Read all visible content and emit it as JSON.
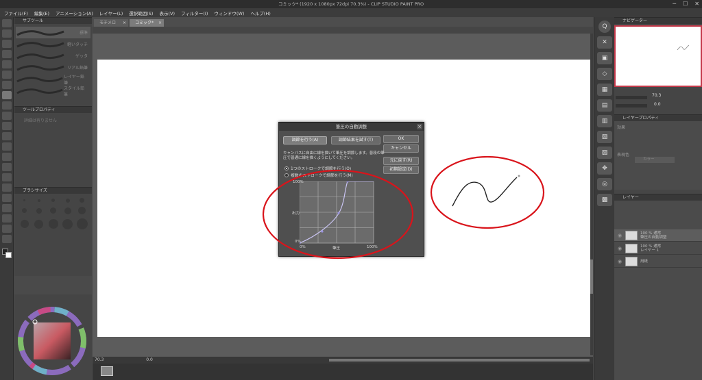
{
  "app": {
    "title": "コミック* (1920 x 1080px 72dpi 70.3%) - CLIP STUDIO PAINT PRO"
  },
  "menu": [
    "ファイル(F)",
    "編集(E)",
    "アニメーション(A)",
    "レイヤー(L)",
    "選択範囲(S)",
    "表示(V)",
    "フィルター(I)",
    "ウィンドウ(W)",
    "ヘルプ(H)"
  ],
  "tabs": [
    {
      "label": "モチメロ"
    },
    {
      "label": "コミック*"
    }
  ],
  "subtool": {
    "panel_title": "サブツール",
    "brushes": [
      {
        "name": "標準"
      },
      {
        "name": "軽いタッチ"
      },
      {
        "name": "ゲッタ"
      },
      {
        "name": "リアル鉛筆"
      },
      {
        "name": "レイヤー鉛筆"
      },
      {
        "name": "スタイル鉛筆"
      }
    ]
  },
  "toolprop": {
    "panel_title": "ツールプロパティ",
    "empty": "詳細は有りません"
  },
  "brushsize": {
    "panel_title": "ブラシサイズ"
  },
  "dialog": {
    "title": "筆圧の自動調整",
    "btn_adjust": "調節を行う(A)",
    "btn_try": "調節結果を試す(T)",
    "btn_ok": "OK",
    "btn_cancel": "キャンセル",
    "btn_undo": "元に戻す(R)",
    "btn_reset": "初期設定(D)",
    "instruction": "キャンバスに自由に線を描いて筆圧を調節します。普段の筆圧で普通に線を描くようにしてください。",
    "radio_single": "1つのストロークで調節を行う(O)",
    "radio_multi": "複数のストロークで調節を行う(M)",
    "graph": {
      "y_top": "100%",
      "y_label": "出力",
      "y_bottom": "0%",
      "x_left": "0%",
      "x_label": "筆圧",
      "x_right": "100%"
    }
  },
  "status": {
    "zoom": "70.3",
    "angle": "0.0"
  },
  "right": {
    "nav_title": "ナビゲーター",
    "nav_zoom": "70.3",
    "nav_angle": "0.0",
    "layerprop_title": "レイヤープロパティ",
    "layerprop_effect": "効果",
    "layerprop_color": "表現色",
    "layerprop_color_value": "カラー",
    "layers_title": "レイヤー",
    "layers": [
      {
        "name": "100 % 通常\n筆圧の自動調整"
      },
      {
        "name": "100 % 通常\nレイヤー 1"
      },
      {
        "name": "用紙"
      }
    ]
  },
  "annotation_color": "#d9141b",
  "colors": {
    "dialog_bg": "#4f4f4f",
    "graph_line": "#9b94e0",
    "canvas": "#ffffff"
  }
}
